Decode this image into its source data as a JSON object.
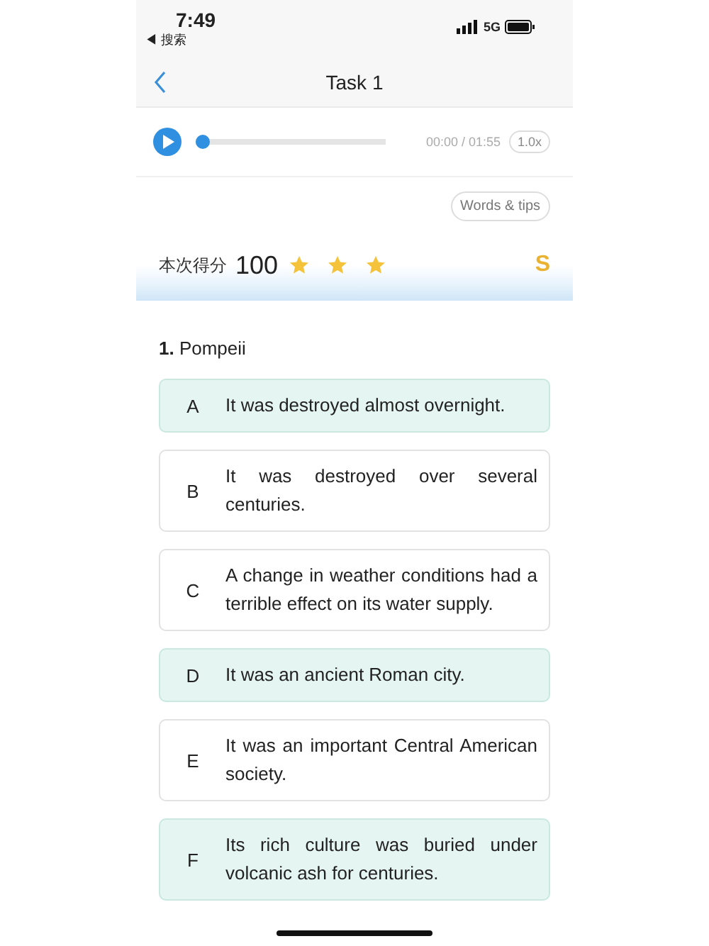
{
  "status_bar": {
    "time": "7:49",
    "back_label": "◀ 搜索",
    "network": "5G"
  },
  "nav": {
    "title": "Task 1"
  },
  "player": {
    "level": 0,
    "time": "00:00 / 01:55",
    "speed": "1.0x"
  },
  "words_tips": "Words & tips",
  "score": {
    "label": "本次得分",
    "value": "100",
    "stars": 3,
    "grade": "S"
  },
  "question": {
    "number": "1.",
    "title": "Pompeii"
  },
  "options": [
    {
      "letter": "A",
      "text": "It was destroyed almost overnight.",
      "selected": true
    },
    {
      "letter": "B",
      "text": "It was destroyed over several centuries.",
      "selected": false
    },
    {
      "letter": "C",
      "text": "A change in weather conditions had a terrible effect on its water supply.",
      "selected": false
    },
    {
      "letter": "D",
      "text": "It was an ancient Roman city.",
      "selected": true
    },
    {
      "letter": "E",
      "text": "It was an important Central American society.",
      "selected": false
    },
    {
      "letter": "F",
      "text": "Its rich culture was buried under volcanic ash for centuries.",
      "selected": true
    }
  ]
}
